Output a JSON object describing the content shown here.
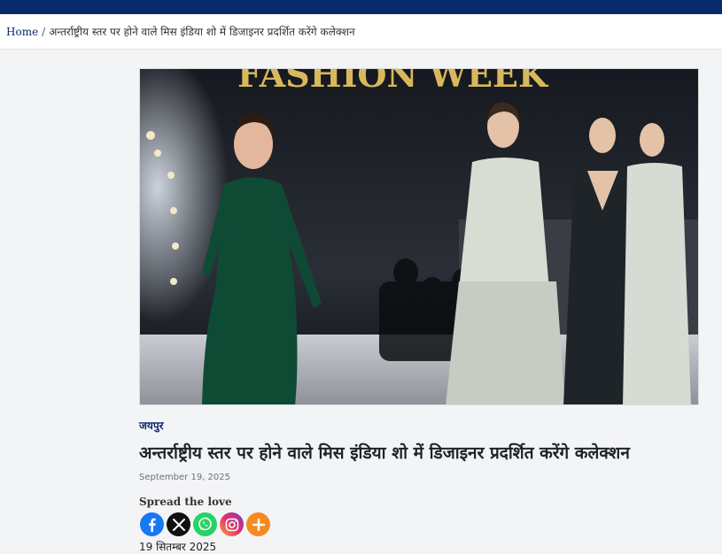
{
  "breadcrumb": {
    "home_label": "Home",
    "separator": "/",
    "current_label": "अन्तर्राष्ट्रीय स्तर पर होने वाले मिस इंडिया शो में डिजाइनर प्रदर्शित करेंगे कलेक्शन"
  },
  "hero": {
    "banner_text": "FASHION WEEK"
  },
  "article": {
    "category": "जयपुर",
    "title": "अन्तर्राष्ट्रीय स्तर पर होने वाले मिस इंडिया शो में डिजाइनर प्रदर्शित करेंगे कलेक्शन",
    "date": "September 19, 2025",
    "hindi_date": "19 सितम्बर 2025"
  },
  "share": {
    "label": "Spread the love",
    "buttons": [
      {
        "name": "facebook",
        "icon": "facebook-icon",
        "color": "#1877f2"
      },
      {
        "name": "x",
        "icon": "x-icon",
        "color": "#111111"
      },
      {
        "name": "whatsapp",
        "icon": "whatsapp-icon",
        "color": "#25d366"
      },
      {
        "name": "instagram",
        "icon": "instagram-icon",
        "color": "#e1306c"
      },
      {
        "name": "more",
        "icon": "plus-icon",
        "color": "#f58a1f"
      }
    ]
  },
  "colors": {
    "brand_navy": "#0a2a6e",
    "page_bg": "#f3f4f6"
  }
}
